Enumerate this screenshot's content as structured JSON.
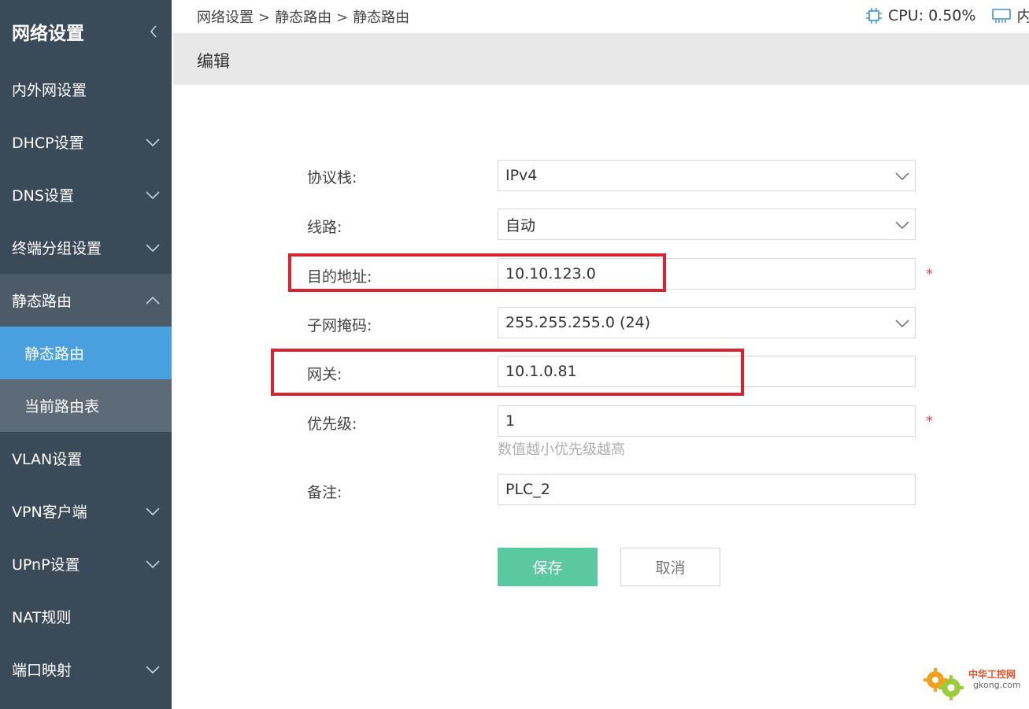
{
  "sidebar": {
    "title": "网络设置",
    "items": [
      {
        "label": "内外网设置"
      },
      {
        "label": "DHCP设置"
      },
      {
        "label": "DNS设置"
      },
      {
        "label": "终端分组设置"
      },
      {
        "label": "静态路由"
      },
      {
        "label": "VLAN设置"
      },
      {
        "label": "VPN客户端"
      },
      {
        "label": "UPnP设置"
      },
      {
        "label": "NAT规则"
      },
      {
        "label": "端口映射"
      }
    ],
    "sub_items": [
      {
        "label": "静态路由"
      },
      {
        "label": "当前路由表"
      }
    ],
    "active_color": "#4aa0df"
  },
  "breadcrumb": {
    "level1": "网络设置",
    "level2": "静态路由",
    "level3": "静态路由",
    "separator": ">"
  },
  "stats": {
    "cpu": "CPU: 0.50%",
    "memory_partial": "内存"
  },
  "page": {
    "title": "编辑"
  },
  "form": {
    "protocol_label": "协议栈:",
    "protocol_value": "IPv4",
    "line_label": "线路:",
    "line_value": "自动",
    "dest_label": "目的地址:",
    "dest_value": "10.10.123.0",
    "mask_label": "子网掩码:",
    "mask_value": "255.255.255.0 (24)",
    "gateway_label": "网关:",
    "gateway_value": "10.1.0.81",
    "priority_label": "优先级:",
    "priority_value": "1",
    "priority_hint": "数值越小优先级越高",
    "remark_label": "备注:",
    "remark_value": "PLC_2",
    "required_mark": "*"
  },
  "buttons": {
    "save": "保存",
    "cancel": "取消"
  },
  "watermark": {
    "name": "中华工控网",
    "url": "gkong.com"
  },
  "colors": {
    "sidebar_bg": "#3b4a59",
    "save_button": "#5bc8a2",
    "highlight_box": "#d7252f"
  }
}
